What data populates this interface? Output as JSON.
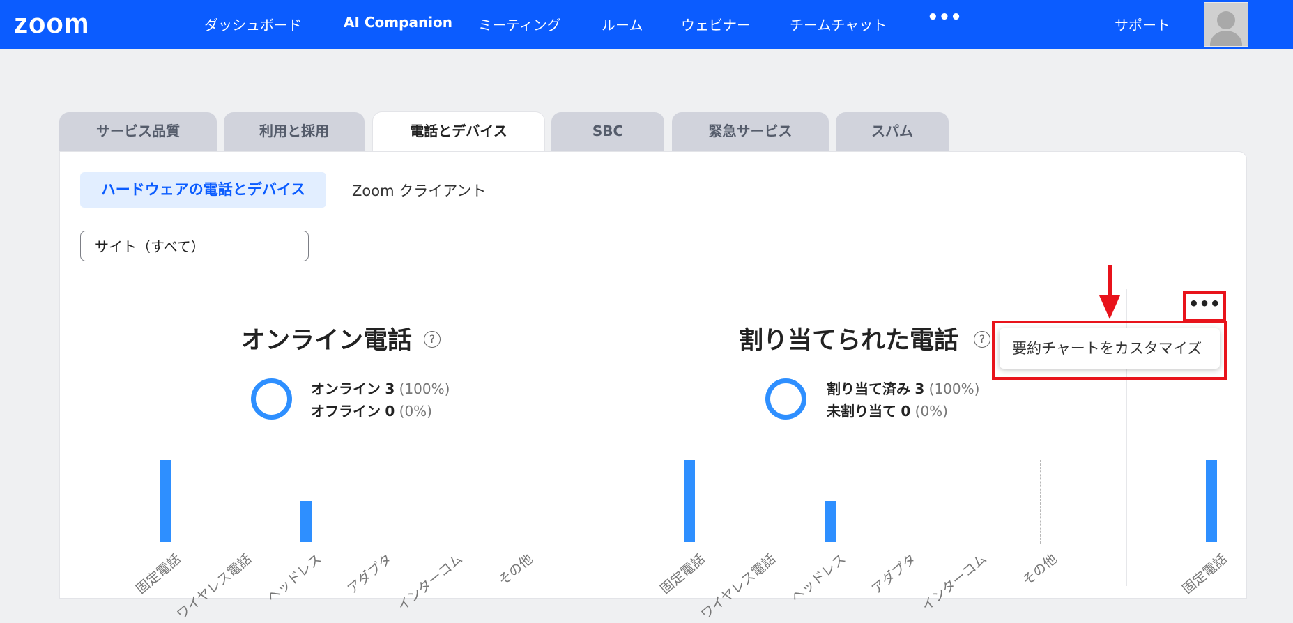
{
  "topbar": {
    "logo": "zoom",
    "nav": [
      "ダッシュボード",
      "AI Companion",
      "ミーティング",
      "ルーム",
      "ウェビナー",
      "チームチャット"
    ],
    "more": "•••",
    "support": "サポート"
  },
  "tabs": [
    "サービス品質",
    "利用と採用",
    "電話とデバイス",
    "SBC",
    "緊急サービス",
    "スパム"
  ],
  "subtabs": {
    "active": "ハードウェアの電話とデバイス",
    "other": "Zoom クライアント"
  },
  "site_select": "サイト（すべて）",
  "cards": [
    {
      "title": "オンライン電話",
      "legend": [
        {
          "label": "オンライン",
          "count": "3",
          "pct": "(100%)"
        },
        {
          "label": "オフライン",
          "count": "0",
          "pct": "(0%)"
        }
      ],
      "ticks": [
        "固定電話",
        "ワイヤレス電話",
        "ヘッドレス",
        "アダプタ",
        "インターコム",
        "その他"
      ]
    },
    {
      "title": "割り当てられた電話",
      "legend": [
        {
          "label": "割り当て済み",
          "count": "3",
          "pct": "(100%)"
        },
        {
          "label": "未割り当て",
          "count": "0",
          "pct": "(0%)"
        }
      ],
      "ticks": [
        "固定電話",
        "ワイヤレス電話",
        "ヘッドレス",
        "アダプタ",
        "インターコム",
        "その他"
      ]
    },
    {
      "ticks": [
        "固定電話"
      ]
    }
  ],
  "chart_data": [
    {
      "type": "bar",
      "categories": [
        "固定電話",
        "ワイヤレス電話",
        "ヘッドレス",
        "アダプタ",
        "インターコム",
        "その他"
      ],
      "values": [
        2,
        0,
        1,
        0,
        0,
        0
      ]
    },
    {
      "type": "bar",
      "categories": [
        "固定電話",
        "ワイヤレス電話",
        "ヘッドレス",
        "アダプタ",
        "インターコム",
        "その他"
      ],
      "values": [
        2,
        0,
        1,
        0,
        0,
        0
      ]
    },
    {
      "type": "bar",
      "categories": [
        "固定電話"
      ],
      "values": [
        2
      ]
    }
  ],
  "menu": {
    "more_label": "•••",
    "popup_item": "要約チャートをカスタマイズ"
  }
}
